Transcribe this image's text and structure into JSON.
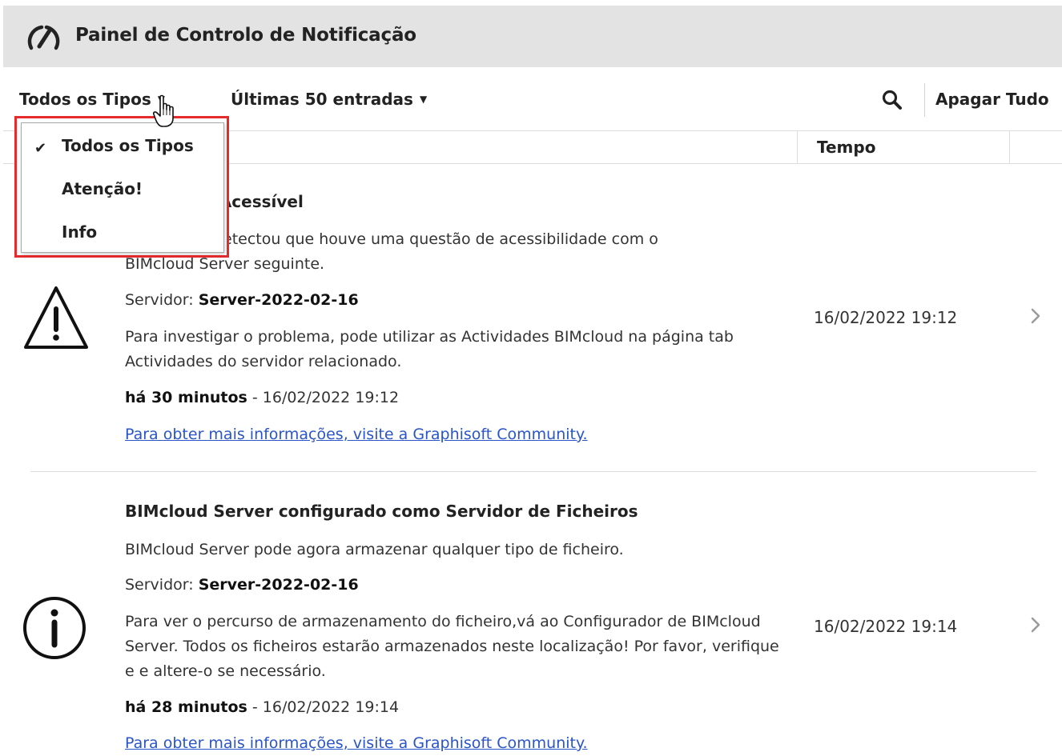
{
  "header": {
    "title": "Painel de Controlo de Notificação"
  },
  "toolbar": {
    "type_filter_label": "Todos os Tipos",
    "entries_filter_label": "Últimas 50 entradas",
    "clear_all_label": "Apagar Tudo"
  },
  "dropdown": {
    "items": [
      {
        "label": "Todos os Tipos",
        "checked": true
      },
      {
        "label": "Atenção!",
        "checked": false
      },
      {
        "label": "Info",
        "checked": false
      }
    ]
  },
  "table": {
    "time_header": "Tempo"
  },
  "notifications": [
    {
      "icon": "warning-icon",
      "title_visible": "erver Não Acessível",
      "desc_line1_visible": "etectou que houve uma questão de acessibilidade com o",
      "desc_line2": "BIMcloud Server seguinte.",
      "server_label": "Servidor:",
      "server_value": "Server-2022-02-16",
      "detail": "Para investigar o problema, pode utilizar as Actividades BIMcloud na página tab Actividades do servidor relacionado.",
      "ago": "há 30 minutos",
      "timestamp": " - 16/02/2022 19:12",
      "link": "Para obter mais informações, visite a Graphisoft Community.",
      "time": "16/02/2022 19:12"
    },
    {
      "icon": "info-icon",
      "title": "BIMcloud Server configurado como Servidor de Ficheiros",
      "description": "BIMcloud Server pode agora armazenar qualquer tipo de ficheiro.",
      "server_label": "Servidor:",
      "server_value": "Server-2022-02-16",
      "detail": "Para ver o percurso de armazenamento do ficheiro,vá ao Configurador de BIMcloud Server. Todos os ficheiros estarão armazenados neste localização! Por favor, verifique e e altere-o se necessário.",
      "ago": "há 28 minutos",
      "timestamp": " - 16/02/2022 19:14",
      "link": "Para obter mais informações, visite a Graphisoft Community.",
      "time": "16/02/2022 19:14"
    }
  ],
  "colors": {
    "highlight": "#e52b2b",
    "link": "#2a55c8",
    "titlebar": "#e3e3e3"
  }
}
